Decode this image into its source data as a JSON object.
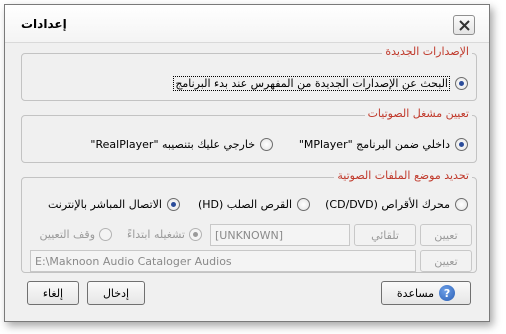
{
  "dialog": {
    "title": "إعدادات"
  },
  "new_versions": {
    "legend": "الإصدارات الجديدة",
    "check_on_start": "البحث عن الإصدارات الجديدة من المفهرس عند بدء البرنامج"
  },
  "audio_player": {
    "legend": "تعيين مشغل الصوتيات",
    "internal": "داخلي ضمن البرنامج \"MPlayer\"",
    "external": "خارجي عليك بتنصيبه \"RealPlayer\""
  },
  "audio_location": {
    "legend": "تحديد موضع الملفات الصوتية",
    "cd_dvd": "محرك الأقراص (CD/DVD)",
    "hard_disk": "القرص الصلب (HD)",
    "internet": "الاتصال المباشر بالإنترنت",
    "set_button_1": "تعيين",
    "auto_button": "تلقائي",
    "drive_value": "[UNKNOWN]",
    "run_initially": "تشغيله ابتداءً",
    "stop_assign": "وقف التعيين",
    "set_button_2": "تعيين",
    "path_value": "E:\\Maknoon Audio Cataloger Audios"
  },
  "footer": {
    "help_label": "مساعدة",
    "enter_label": "إدخال",
    "cancel_label": "إلغاء"
  }
}
